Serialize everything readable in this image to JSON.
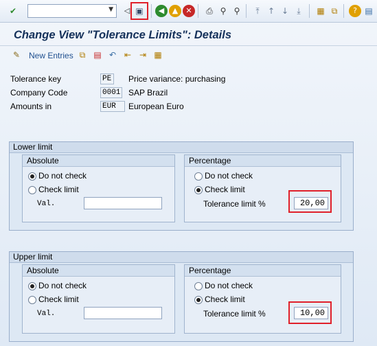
{
  "toolbar": {
    "command_field_value": "",
    "icons": [
      "enter-icon",
      "save-icon",
      "back-icon",
      "exit-icon",
      "cancel-icon",
      "print-icon",
      "find-icon",
      "find-next-icon",
      "first-page-icon",
      "previous-page-icon",
      "next-page-icon",
      "last-page-icon",
      "create-session-icon",
      "shortcut-icon",
      "help-icon",
      "layout-menu-icon"
    ]
  },
  "title": "Change View \"Tolerance Limits\": Details",
  "app_toolbar": {
    "new_entries_label": "New Entries"
  },
  "header": {
    "tolerance_key_label": "Tolerance key",
    "tolerance_key_value": "PE",
    "tolerance_key_desc": "Price variance: purchasing",
    "company_code_label": "Company Code",
    "company_code_value": "0001",
    "company_code_desc": "SAP Brazil",
    "amounts_in_label": "Amounts in",
    "amounts_in_value": "EUR",
    "amounts_in_desc": "European Euro"
  },
  "lower_limit": {
    "title": "Lower limit",
    "absolute": {
      "title": "Absolute",
      "do_not_check": "Do not check",
      "check_limit": "Check limit",
      "selected": "do_not_check",
      "val_label": "Val.",
      "val_value": ""
    },
    "percentage": {
      "title": "Percentage",
      "do_not_check": "Do not check",
      "check_limit": "Check limit",
      "selected": "check_limit",
      "tol_label": "Tolerance limit %",
      "tol_value": "20,00"
    }
  },
  "upper_limit": {
    "title": "Upper limit",
    "absolute": {
      "title": "Absolute",
      "do_not_check": "Do not check",
      "check_limit": "Check limit",
      "selected": "do_not_check",
      "val_label": "Val.",
      "val_value": ""
    },
    "percentage": {
      "title": "Percentage",
      "do_not_check": "Do not check",
      "check_limit": "Check limit",
      "selected": "check_limit",
      "tol_label": "Tolerance limit %",
      "tol_value": "10,00"
    }
  },
  "colors": {
    "highlight": "#e0202a",
    "title_text": "#15315a",
    "link_text": "#1f4f8f"
  }
}
